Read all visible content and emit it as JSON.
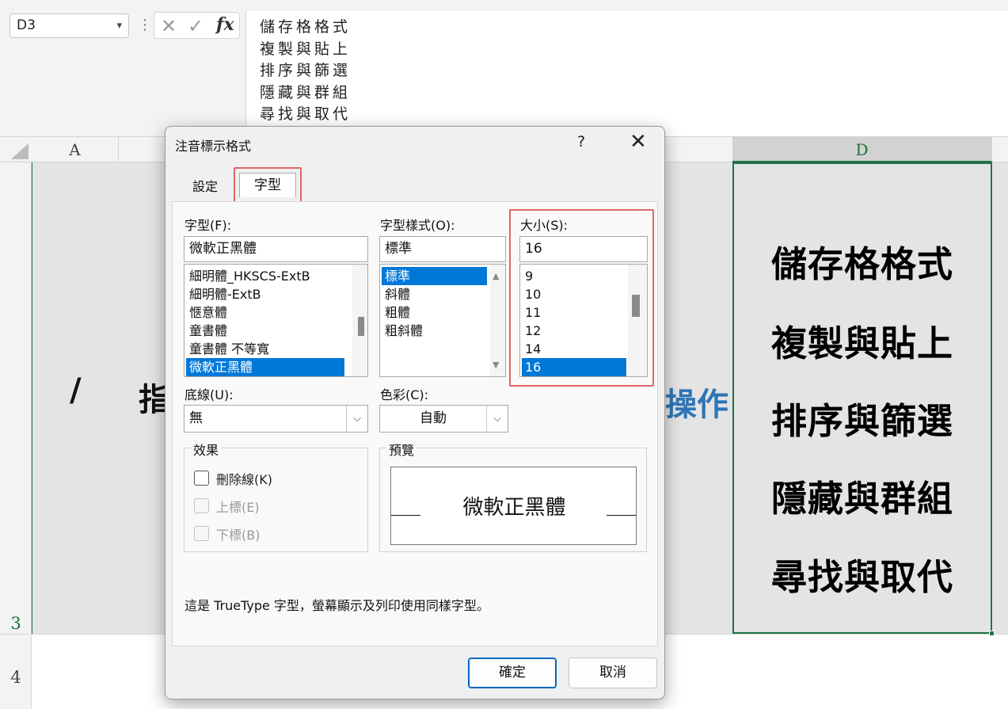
{
  "formula_bar": {
    "name_box": "D3",
    "cancel_icon": "✕",
    "enter_icon": "✓",
    "fx_label": "fx",
    "content_lines": [
      "儲存格格式",
      "複製與貼上",
      "排序與篩選",
      "隱藏與群組",
      "尋找與取代"
    ]
  },
  "sheet": {
    "column_headers": {
      "a": "A",
      "d": "D"
    },
    "row_numbers": {
      "r3": "3",
      "r4": "4"
    },
    "cell_left_fragment": "/",
    "cell_left_fragment2": "指",
    "cell_right_fragment": "操作",
    "d3_lines": [
      "儲存格格式",
      "複製與貼上",
      "排序與篩選",
      "隱藏與群組",
      "尋找與取代"
    ]
  },
  "dialog": {
    "title": "注音標示格式",
    "help": "?",
    "close": "✕",
    "tabs": {
      "settings": "設定",
      "font": "字型"
    },
    "font_label": "字型(F):",
    "font_value": "微軟正黑體",
    "font_list": [
      "細明體_HKSCS-ExtB",
      "細明體-ExtB",
      "愜意體",
      "童書體",
      "童書體 不等寬",
      "微軟正黑體"
    ],
    "style_label": "字型樣式(O):",
    "style_value": "標準",
    "style_list": [
      "標準",
      "斜體",
      "粗體",
      "粗斜體"
    ],
    "size_label": "大小(S):",
    "size_value": "16",
    "size_list": [
      "9",
      "10",
      "11",
      "12",
      "14",
      "16"
    ],
    "underline_label": "底線(U):",
    "underline_value": "無",
    "color_label": "色彩(C):",
    "color_value": "自動",
    "effects_title": "效果",
    "effects": {
      "strikethrough": "刪除線(K)",
      "superscript": "上標(E)",
      "subscript": "下標(B)"
    },
    "preview_title": "預覽",
    "preview_text": "微軟正黑體",
    "truetype_note": "這是 TrueType 字型，螢幕顯示及列印使用同樣字型。",
    "ok": "確定",
    "cancel": "取消"
  },
  "colors": {
    "excel_green": "#217346",
    "selection_blue": "#0078d7",
    "highlight_red": "#e06666"
  }
}
